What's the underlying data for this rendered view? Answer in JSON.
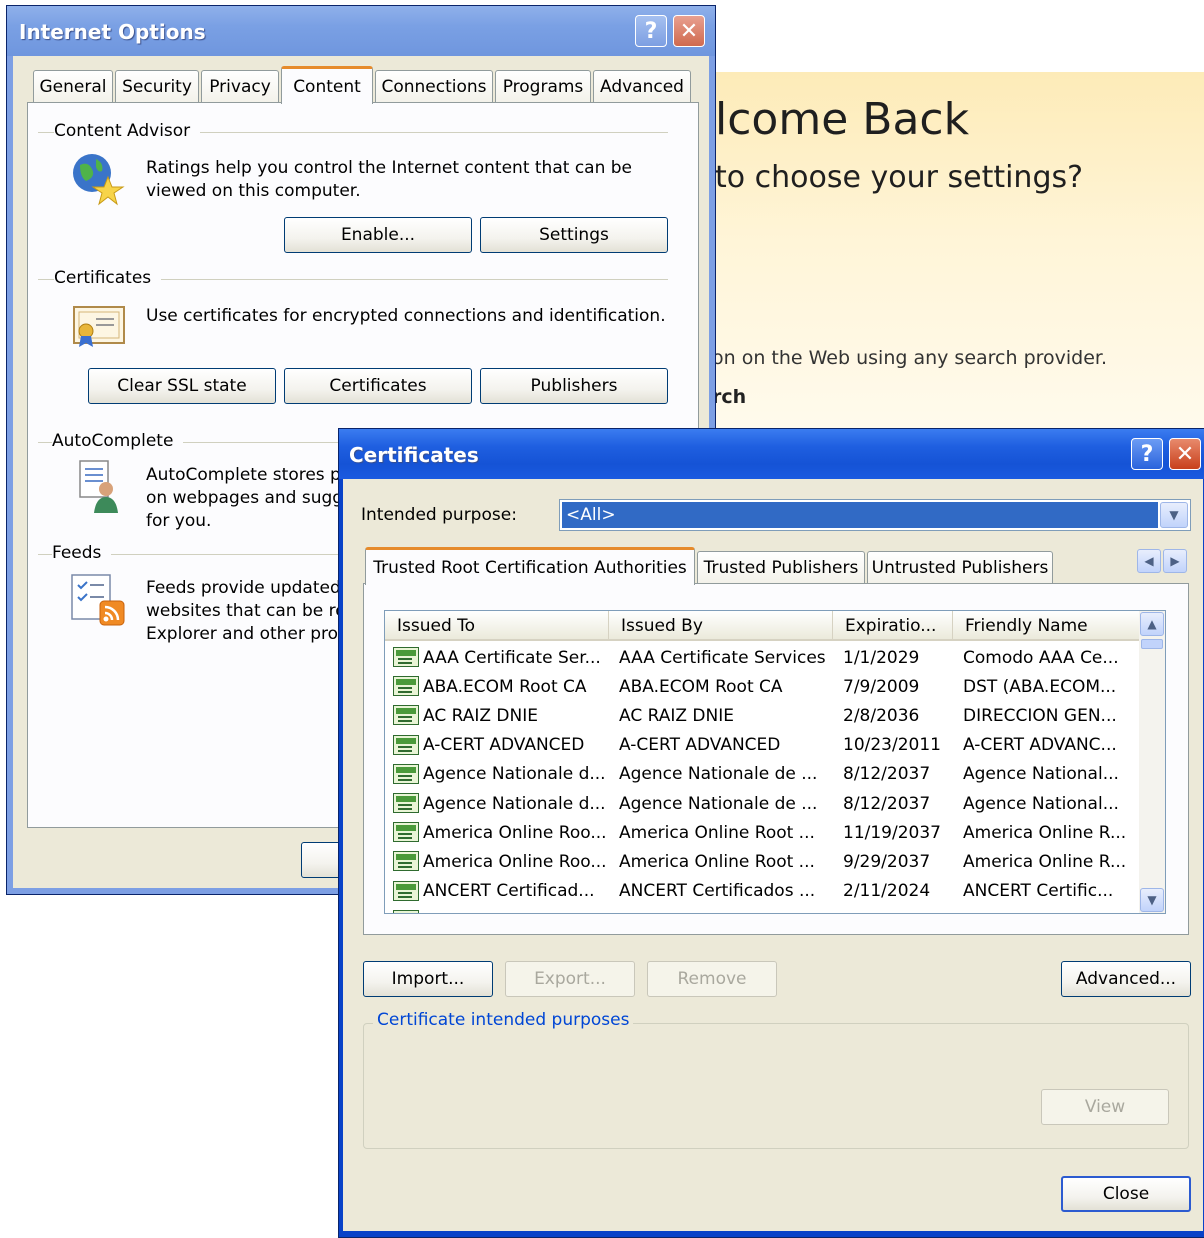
{
  "background_page": {
    "title": "lcome Back",
    "subtitle": "to choose your settings?",
    "line1": "on on the Web using any search provider.",
    "line2": "rch"
  },
  "internet_options": {
    "title": "Internet Options",
    "help_glyph": "?",
    "close_glyph": "✕",
    "tabs": [
      "General",
      "Security",
      "Privacy",
      "Content",
      "Connections",
      "Programs",
      "Advanced"
    ],
    "selected_tab": "Content",
    "content_advisor": {
      "label": "Content Advisor",
      "description_line1": "Ratings help you control the Internet content that can be",
      "description_line2": "viewed on this computer.",
      "enable_button": "Enable...",
      "settings_button": "Settings"
    },
    "certificates": {
      "label": "Certificates",
      "description": "Use certificates for encrypted connections and identification.",
      "clear_ssl_button": "Clear SSL state",
      "certificates_button": "Certificates",
      "publishers_button": "Publishers"
    },
    "autocomplete": {
      "label": "AutoComplete",
      "line1": "AutoComplete stores pr",
      "line2": "on webpages and sugge",
      "line3": "for you."
    },
    "feeds": {
      "label": "Feeds",
      "line1": "Feeds provide updated",
      "line2": "websites that can be re",
      "line3": "Explorer and other prog"
    }
  },
  "certificates_dialog": {
    "title": "Certificates",
    "help_glyph": "?",
    "close_glyph": "✕",
    "intended_purpose_label": "Intended purpose:",
    "intended_purpose_value": "<All>",
    "tabs": [
      "Trusted Root Certification Authorities",
      "Trusted Publishers",
      "Untrusted Publishers"
    ],
    "selected_tab": "Trusted Root Certification Authorities",
    "columns": [
      "Issued To",
      "Issued By",
      "Expiratio...",
      "Friendly Name"
    ],
    "rows": [
      [
        "AAA Certificate Ser...",
        "AAA Certificate Services",
        "1/1/2029",
        "Comodo AAA Ce..."
      ],
      [
        "ABA.ECOM Root CA",
        "ABA.ECOM Root CA",
        "7/9/2009",
        "DST (ABA.ECOM..."
      ],
      [
        "AC RAIZ DNIE",
        "AC RAIZ DNIE",
        "2/8/2036",
        "DIRECCION GEN..."
      ],
      [
        "A-CERT ADVANCED",
        "A-CERT ADVANCED",
        "10/23/2011",
        "A-CERT ADVANC..."
      ],
      [
        "Agence Nationale d...",
        "Agence Nationale de ...",
        "8/12/2037",
        "Agence National..."
      ],
      [
        "Agence Nationale d...",
        "Agence Nationale de ...",
        "8/12/2037",
        "Agence National..."
      ],
      [
        "America Online Roo...",
        "America Online Root ...",
        "11/19/2037",
        "America Online R..."
      ],
      [
        "America Online Roo...",
        "America Online Root ...",
        "9/29/2037",
        "America Online R..."
      ],
      [
        "ANCERT Certificad...",
        "ANCERT Certificados ...",
        "2/11/2024",
        "ANCERT Certific..."
      ]
    ],
    "import_button": "Import...",
    "export_button": "Export...",
    "remove_button": "Remove",
    "advanced_button": "Advanced...",
    "purposes_label": "Certificate intended purposes",
    "view_button": "View",
    "close_button": "Close"
  }
}
